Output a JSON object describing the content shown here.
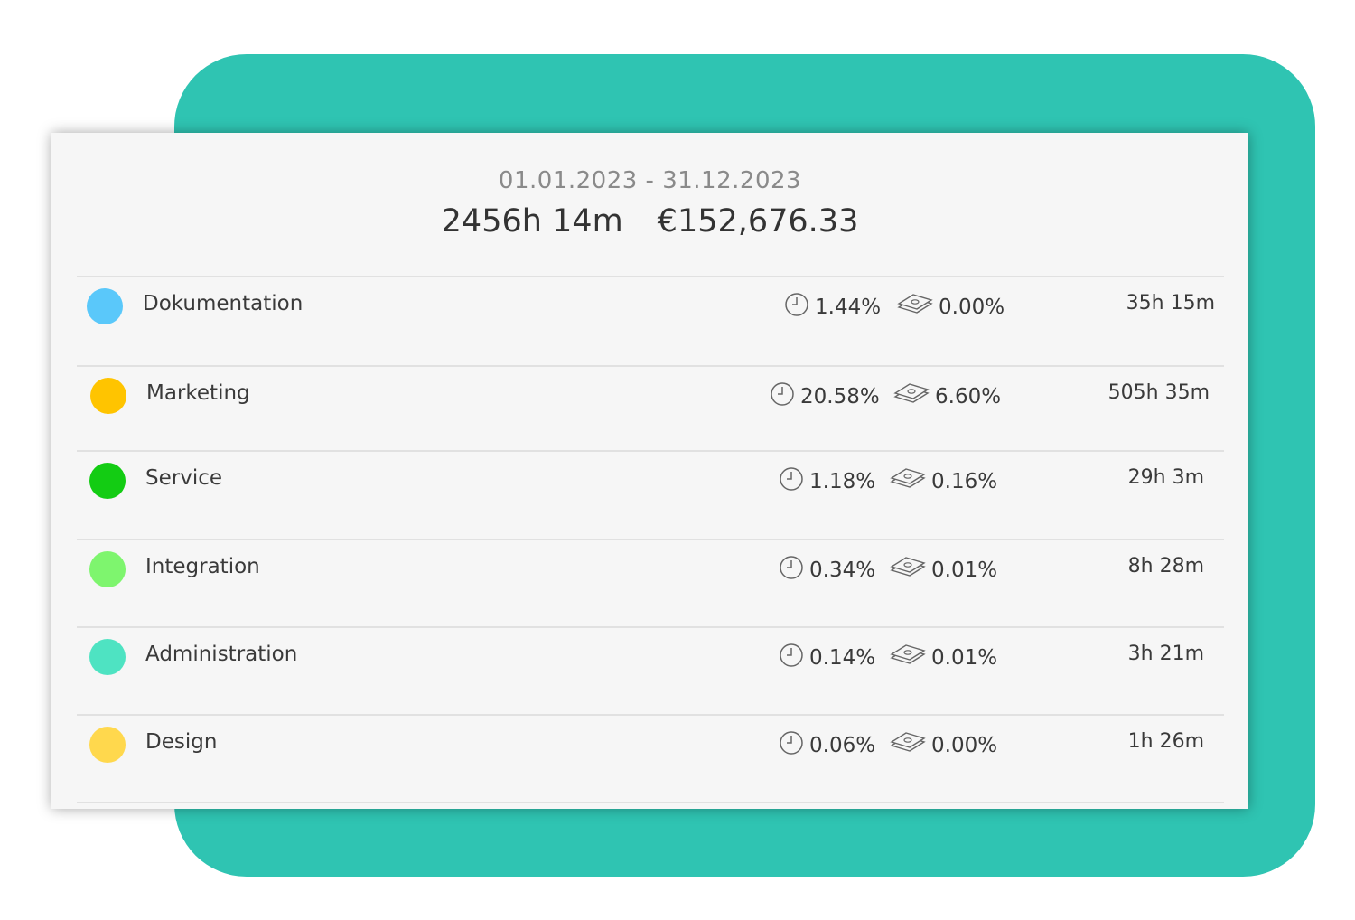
{
  "summary": {
    "date_range": "01.01.2023 - 31.12.2023",
    "total_time": "2456h 14m",
    "total_amount": "€152,676.33"
  },
  "categories": [
    {
      "name": "Dokumentation",
      "color": "#5ac8fa",
      "time_pct": "1.44%",
      "money_pct": "0.00%",
      "duration": "35h 15m"
    },
    {
      "name": "Marketing",
      "color": "#ffc400",
      "time_pct": "20.58%",
      "money_pct": "6.60%",
      "duration": "505h 35m"
    },
    {
      "name": "Service",
      "color": "#13cc13",
      "time_pct": "1.18%",
      "money_pct": "0.16%",
      "duration": "29h 3m"
    },
    {
      "name": "Integration",
      "color": "#7ef56e",
      "time_pct": "0.34%",
      "money_pct": "0.01%",
      "duration": "8h 28m"
    },
    {
      "name": "Administration",
      "color": "#4ee3c2",
      "time_pct": "0.14%",
      "money_pct": "0.01%",
      "duration": "3h 21m"
    },
    {
      "name": "Design",
      "color": "#ffd84d",
      "time_pct": "0.06%",
      "money_pct": "0.00%",
      "duration": "1h 26m"
    }
  ],
  "icons": {
    "time": "clock-icon",
    "money": "money-stack-icon"
  }
}
